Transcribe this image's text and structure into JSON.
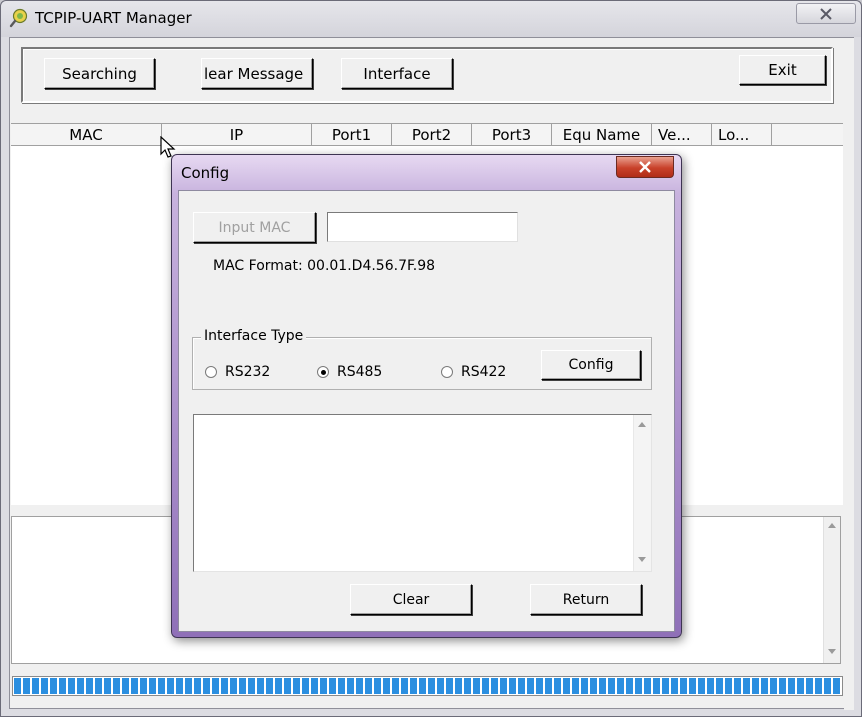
{
  "window": {
    "title": "TCPIP-UART Manager",
    "close_icon": "close-icon"
  },
  "toolbar": {
    "searching_label": "Searching",
    "clear_message_label": "lear Message",
    "interface_label": "Interface",
    "exit_label": "Exit"
  },
  "table": {
    "columns": [
      "MAC",
      "IP",
      "Port1",
      "Port2",
      "Port3",
      "Equ Name",
      "Ve...",
      "Lo..."
    ]
  },
  "progress": {
    "fraction": 1.0,
    "color": "#2b8fe0"
  },
  "dialog": {
    "title": "Config",
    "input_mac_label": "Input MAC",
    "mac_value": "",
    "mac_format_text": "MAC Format: 00.01.D4.56.7F.98",
    "interface_type_legend": "Interface Type",
    "radios": [
      {
        "label": "RS232",
        "selected": false
      },
      {
        "label": "RS485",
        "selected": true
      },
      {
        "label": "RS422",
        "selected": false
      }
    ],
    "config_label": "Config",
    "clear_label": "Clear",
    "return_label": "Return",
    "close_button_color": "#c8412a"
  }
}
